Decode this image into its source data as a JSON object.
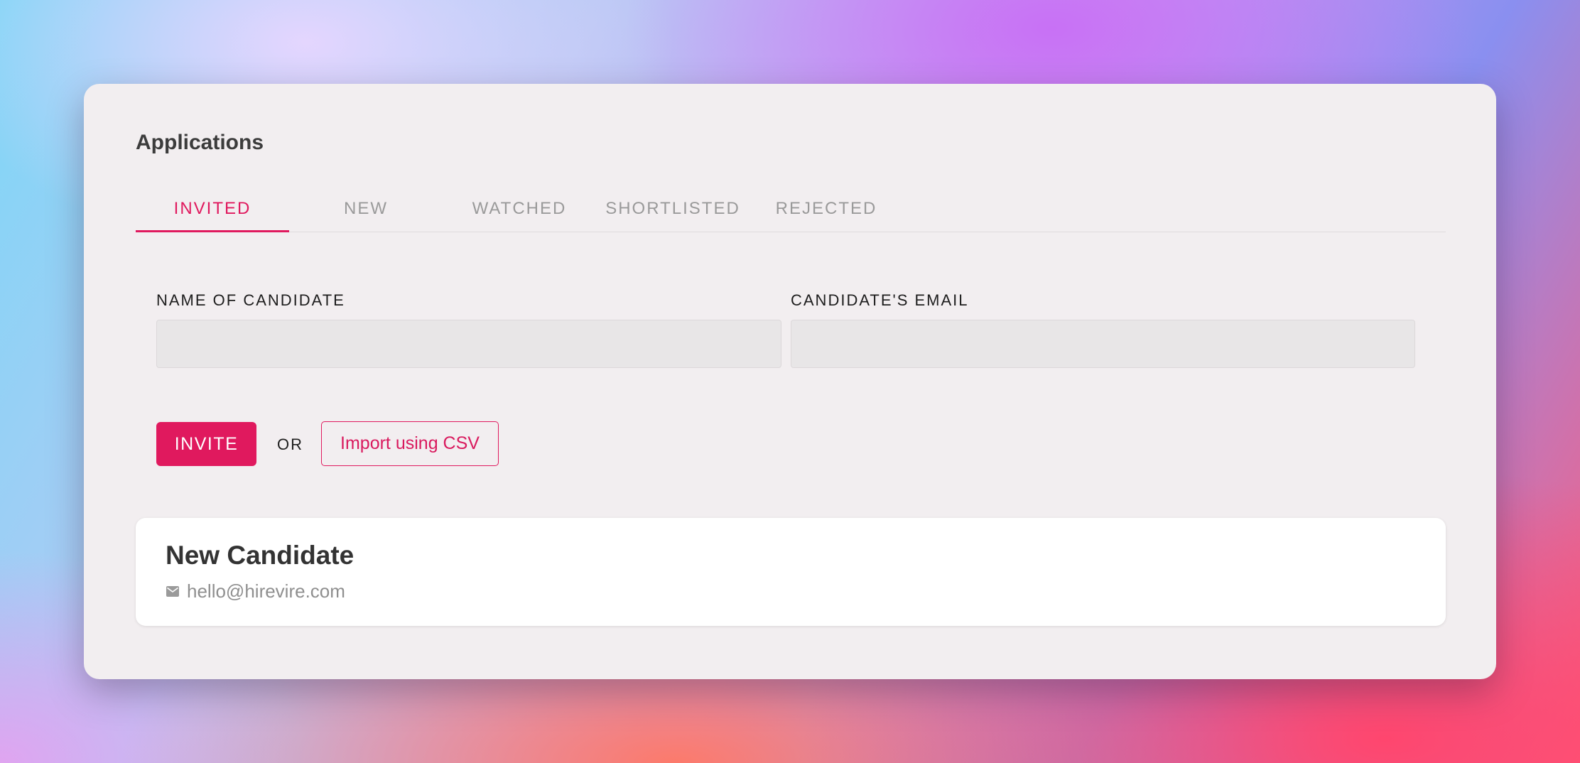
{
  "page": {
    "title": "Applications"
  },
  "tabs": [
    {
      "label": "INVITED",
      "active": true
    },
    {
      "label": "NEW",
      "active": false
    },
    {
      "label": "WATCHED",
      "active": false
    },
    {
      "label": "SHORTLISTED",
      "active": false
    },
    {
      "label": "REJECTED",
      "active": false
    }
  ],
  "form": {
    "name_label": "NAME OF CANDIDATE",
    "name_value": "",
    "email_label": "CANDIDATE'S EMAIL",
    "email_value": ""
  },
  "actions": {
    "invite_label": "INVITE",
    "or_label": "OR",
    "import_label": "Import using CSV"
  },
  "candidates": [
    {
      "name": "New Candidate",
      "email": "hello@hirevire.com",
      "icon": "mail-icon"
    }
  ],
  "colors": {
    "accent": "#e0195e",
    "card_background": "#f2eef0",
    "muted_text": "#9a9a9a"
  }
}
